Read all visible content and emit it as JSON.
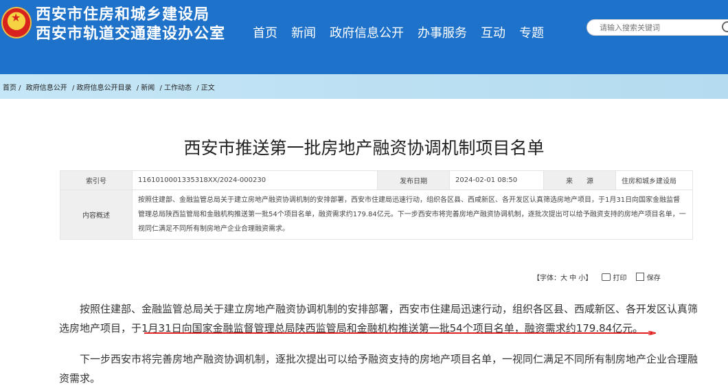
{
  "header": {
    "site_name_line1": "西安市住房和城乡建设局",
    "site_name_line2": "西安市轨道交通建设办公室",
    "nav": [
      "首页",
      "新闻",
      "政府信息公开",
      "办事服务",
      "互动",
      "专题"
    ],
    "search_placeholder": "请输入搜索关键词"
  },
  "breadcrumb": [
    "首页 /",
    "政府信息公开",
    "/ 政府信息公开目录",
    "/ 新闻",
    "/ 工作动态",
    "/ 正文"
  ],
  "article": {
    "title": "西安市推送第一批房地产融资协调机制项目名单",
    "meta": {
      "index_label": "索引号",
      "index_value": "1161010001335318XX/2024-000230",
      "date_label": "发布日期",
      "date_value": "2024-02-01 08:50",
      "source_label": "来　　源",
      "source_value": "住房和城乡建设局",
      "summary_label": "内容概述",
      "summary_value": "按照住建部、金融监管总局关于建立房地产融资协调机制的安排部署，西安市住建局迅速行动，组织各区县、西咸新区、各开发区认真筛选房地产项目，于1月31日向国家金融监督管理总局陕西监管局和金融机构推送第一批54个项目名单，融资需求约179.84亿元。下一步西安市将完善房地产融资协调机制，逐批次提出可以给予融资支持的房地产项目名单，一视同仁满足不同所有制房地产企业合理融资需求。"
    },
    "tools": {
      "font_size": "【字体：大 中 小】",
      "print": "打印",
      "save": "保存"
    },
    "paragraph1": "按照住建部、金融监管总局关于建立房地产融资协调机制的安排部署，西安市住建局迅速行动，组织各区县、西咸新区、各开发区认真筛选房地产项目，于1月31日向国家金融监督管理总局陕西监管局和金融机构推送第一批54个项目名单，融资需求约179.84亿元。",
    "paragraph2": "下一步西安市将完善房地产融资协调机制，逐批次提出可以给予融资支持的房地产项目名单，一视同仁满足不同所有制房地产企业合理融资需求。"
  },
  "colors": {
    "header_bg": "#1f72c9",
    "crumb_bg": "#c5e6f6",
    "annotation_red": "#e02020"
  }
}
